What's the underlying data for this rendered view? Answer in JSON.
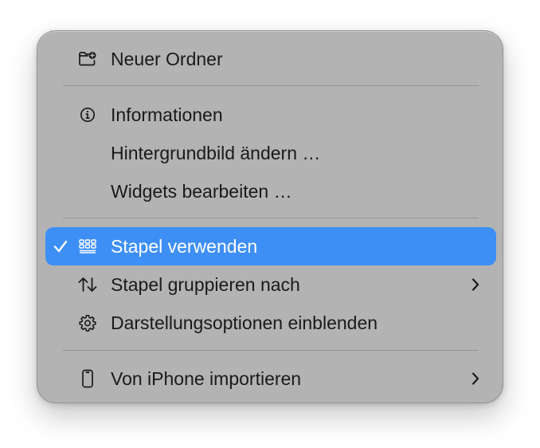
{
  "menu": {
    "items": [
      {
        "label": "Neuer Ordner",
        "icon": "new-folder-icon"
      },
      {
        "label": "Informationen",
        "icon": "info-icon"
      },
      {
        "label": "Hintergrundbild ändern …"
      },
      {
        "label": "Widgets bearbeiten …"
      },
      {
        "label": "Stapel verwenden",
        "icon": "stack-grid-icon",
        "checked": true,
        "selected": true
      },
      {
        "label": "Stapel gruppieren nach",
        "icon": "sort-arrows-icon",
        "submenu": true
      },
      {
        "label": "Darstellungsoptionen einblenden",
        "icon": "gear-icon"
      },
      {
        "label": "Von iPhone importieren",
        "icon": "iphone-icon",
        "submenu": true
      }
    ]
  },
  "colors": {
    "menu_background": "#b3b3b3",
    "selection": "#3e8ff5",
    "text": "#1a1a1a",
    "selected_text": "#ffffff"
  }
}
